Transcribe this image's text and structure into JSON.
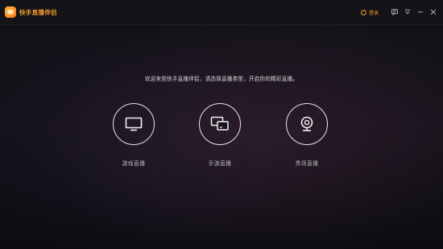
{
  "app": {
    "title": "快手直播伴侣"
  },
  "header": {
    "login_label": "登录"
  },
  "main": {
    "welcome_text": "欢迎来到快手直播伴侣，请选择直播类型，开启你的精彩直播。",
    "options": [
      {
        "label": "游戏直播",
        "icon": "monitor-icon"
      },
      {
        "label": "手游直播",
        "icon": "phone-screen-icon"
      },
      {
        "label": "秀场直播",
        "icon": "webcam-icon"
      }
    ]
  },
  "colors": {
    "accent": "#f09a2a",
    "background": "#121218",
    "circle_stroke": "#e6e6ea"
  }
}
